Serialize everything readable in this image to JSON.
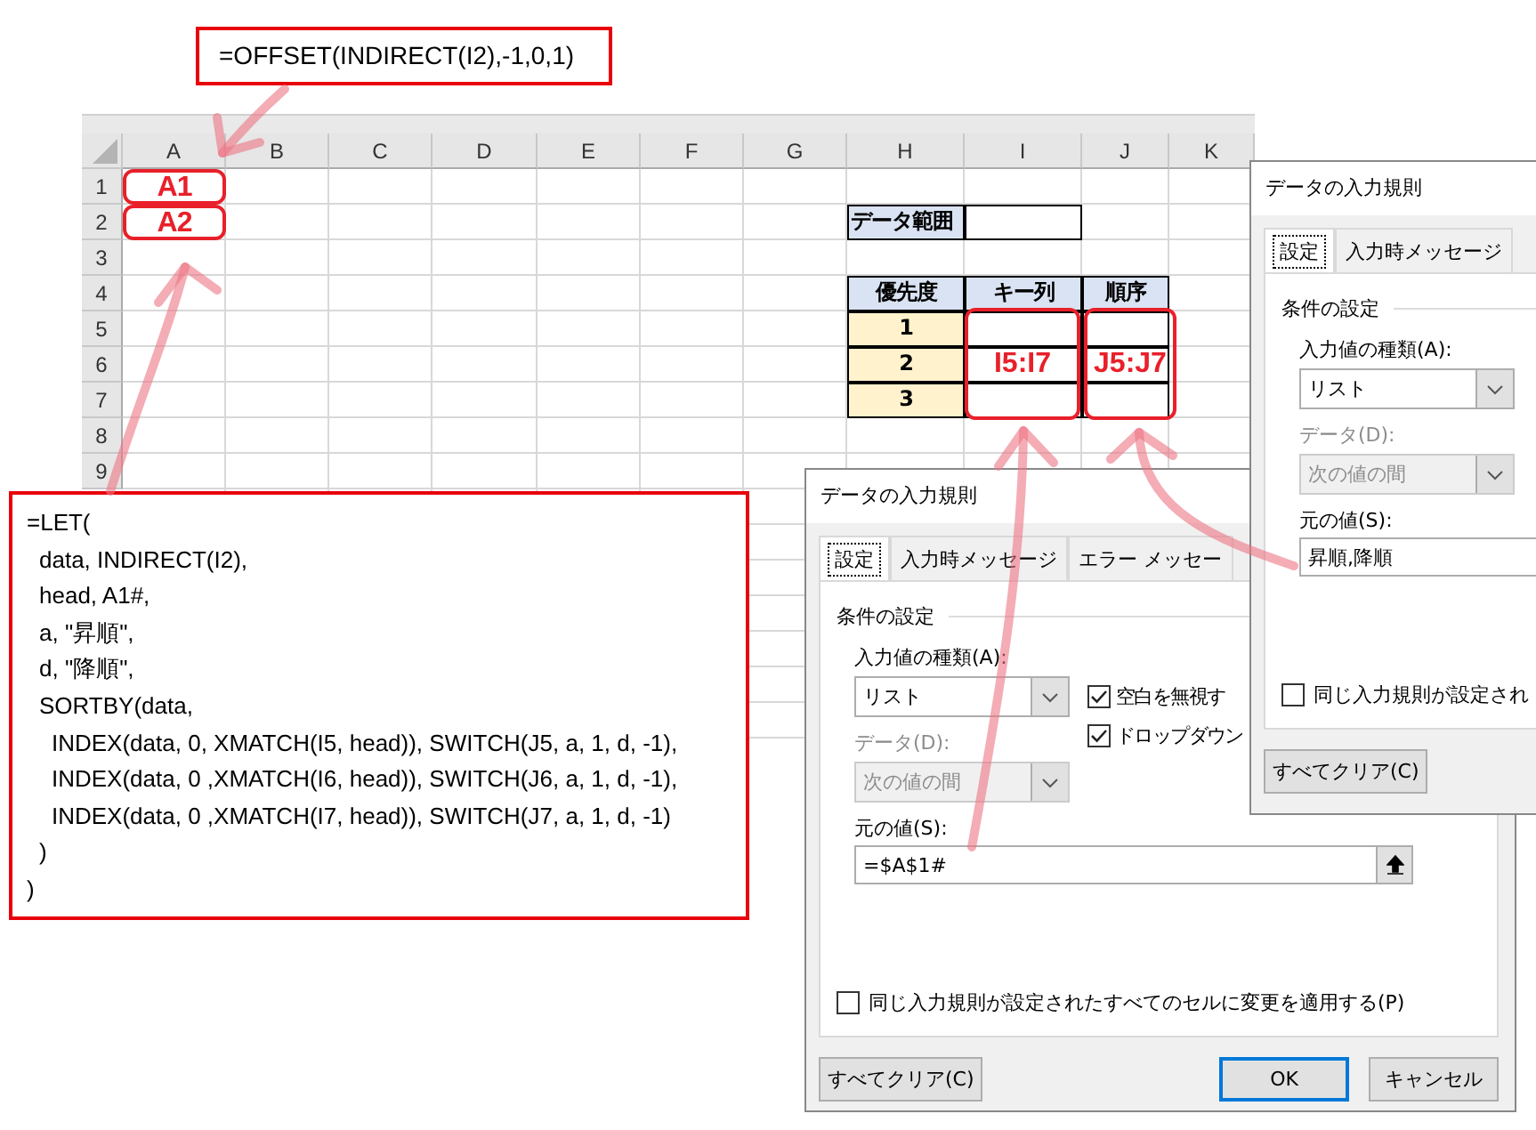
{
  "offset_callout": {
    "text": "=OFFSET(INDIRECT(I2),-1,0,1)"
  },
  "sheet": {
    "columns": [
      "A",
      "B",
      "C",
      "D",
      "E",
      "F",
      "G",
      "H",
      "I",
      "J",
      "K"
    ],
    "row_numbers": [
      "1",
      "2",
      "3",
      "4",
      "5",
      "6",
      "7",
      "8",
      "9"
    ],
    "data_range_label": "データ範囲",
    "priority_table": {
      "columns": [
        "優先度",
        "キー列",
        "順序"
      ],
      "rows": [
        "1",
        "2",
        "3"
      ]
    },
    "annotations": [
      {
        "text": "A1"
      },
      {
        "text": "A2"
      },
      {
        "text": "I5:I7"
      },
      {
        "text": "J5:J7"
      }
    ]
  },
  "let_callout": {
    "lines": [
      {
        "text": "=LET(",
        "children": [
          {
            "text": "data, INDIRECT(I2),"
          },
          {
            "text": "head, A1#,"
          },
          {
            "text": "a, \"昇順\","
          },
          {
            "text": "d, \"降順\","
          },
          {
            "text": "SORTBY(data,",
            "children": [
              {
                "text": "INDEX(data, 0, XMATCH(I5, head)), SWITCH(J5, a, 1, d, -1),"
              },
              {
                "text": "INDEX(data, 0 ,XMATCH(I6, head)), SWITCH(J6, a, 1, d, -1),"
              },
              {
                "text": "INDEX(data, 0 ,XMATCH(I7, head)), SWITCH(J7, a, 1, d, -1)"
              }
            ]
          },
          {
            "text": ")"
          }
        ]
      },
      {
        "text": ")"
      }
    ]
  },
  "dialogs": [
    {
      "title": "データの入力規則",
      "tabs": [
        {
          "label": "設定",
          "selected": true
        },
        {
          "label": "入力時メッセージ",
          "selected": false
        }
      ],
      "section_title": "条件の設定",
      "type_field": {
        "label": "入力値の種類(A):",
        "value": "リスト",
        "disabled": false
      },
      "data_field": {
        "label": "データ(D):",
        "value": "次の値の間",
        "disabled": true
      },
      "source_field": {
        "label": "元の値(S):",
        "value": "昇順,降順"
      },
      "apply_all": {
        "label": "同じ入力規則が設定され",
        "checked": false
      },
      "buttons": [
        {
          "label": "すべてクリア(C)",
          "kind": "clear"
        }
      ]
    },
    {
      "title": "データの入力規則",
      "tabs": [
        {
          "label": "設定",
          "selected": true
        },
        {
          "label": "入力時メッセージ",
          "selected": false
        },
        {
          "label": "エラー メッセー",
          "selected": false
        }
      ],
      "section_title": "条件の設定",
      "type_field": {
        "label": "入力値の種類(A):",
        "value": "リスト",
        "disabled": false
      },
      "data_field": {
        "label": "データ(D):",
        "value": "次の値の間",
        "disabled": true
      },
      "checkboxes": [
        {
          "label": "空白を無視す",
          "checked": true
        },
        {
          "label": "ドロップダウン",
          "checked": true
        }
      ],
      "source_field": {
        "label": "元の値(S):",
        "value": "=$A$1#",
        "range_button": true
      },
      "apply_all": {
        "label": "同じ入力規則が設定されたすべてのセルに変更を適用する(P)",
        "checked": false
      },
      "buttons": [
        {
          "label": "すべてクリア(C)",
          "kind": "clear"
        },
        {
          "label": "OK",
          "kind": "default"
        },
        {
          "label": "キャンセル",
          "kind": "normal"
        }
      ]
    }
  ]
}
